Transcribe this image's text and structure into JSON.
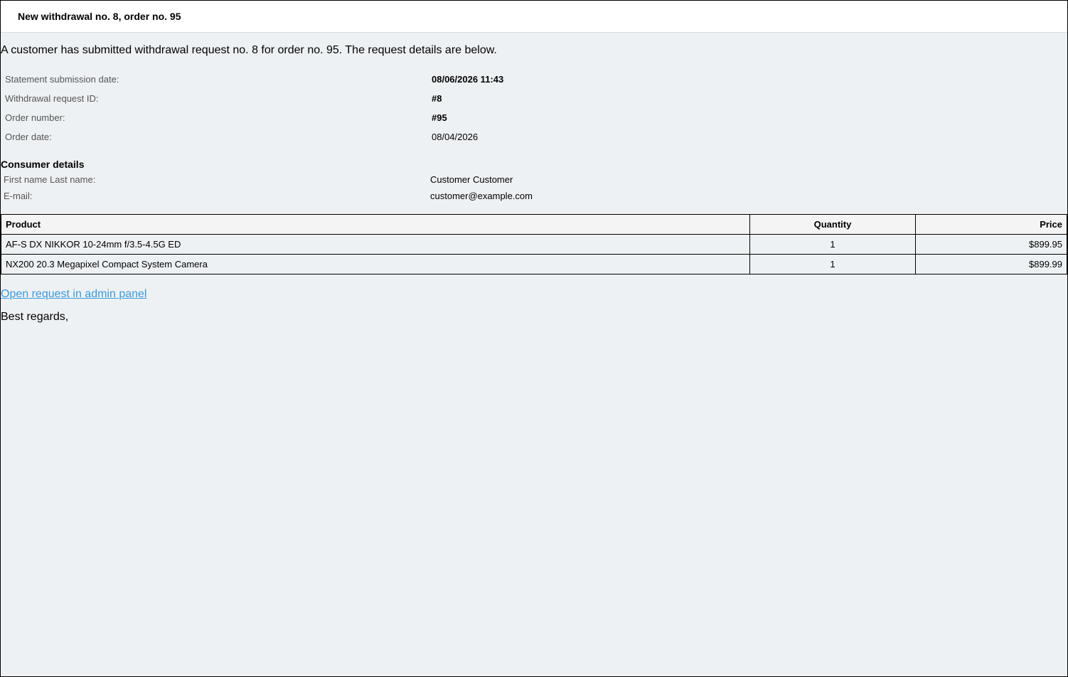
{
  "email": {
    "subject": "New withdrawal no. 8, order no. 95",
    "intro": "A customer has submitted withdrawal request no. 8 for order no. 95. The request details are below.",
    "details": [
      {
        "label": "Statement submission date:",
        "value": "08/06/2026 11:43"
      },
      {
        "label": "Withdrawal request ID:",
        "value": "#8"
      },
      {
        "label": "Order number:",
        "value": "#95"
      },
      {
        "label": "Order date:",
        "value": "08/04/2026"
      }
    ],
    "consumer_title": "Consumer details",
    "consumer": [
      {
        "label": "First name Last name:",
        "value": "Customer Customer"
      },
      {
        "label": "E-mail:",
        "value": "customer@example.com"
      }
    ],
    "products": {
      "headers": {
        "product": "Product",
        "quantity": "Quantity",
        "price": "Price"
      },
      "rows": [
        {
          "product": "AF-S DX NIKKOR 10-24mm f/3.5-4.5G ED",
          "quantity": "1",
          "price": "$899.95"
        },
        {
          "product": "NX200 20.3 Megapixel Compact System Camera",
          "quantity": "1",
          "price": "$899.99"
        }
      ]
    },
    "admin_link_label": "Open request in admin panel",
    "closing": "Best regards,"
  },
  "colors": {
    "background": "#eef1f4",
    "link": "#3a9ad9"
  }
}
